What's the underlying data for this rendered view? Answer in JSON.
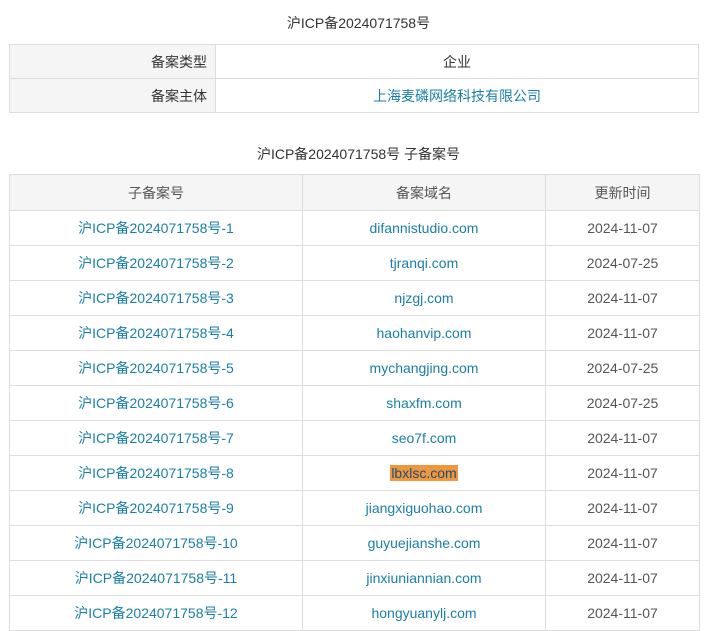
{
  "page": {
    "title": "沪ICP备2024071758号",
    "subtitle": "沪ICP备2024071758号 子备案号"
  },
  "info": {
    "rows": [
      {
        "label": "备案类型",
        "value": "企业"
      },
      {
        "label": "备案主体",
        "value": "上海麦磷网络科技有限公司"
      }
    ]
  },
  "subtable": {
    "headers": [
      "子备案号",
      "备案域名",
      "更新时间"
    ],
    "rows": [
      {
        "number": "沪ICP备2024071758号-1",
        "domain": "difannistudio.com",
        "date": "2024-11-07"
      },
      {
        "number": "沪ICP备2024071758号-2",
        "domain": "tjranqi.com",
        "date": "2024-07-25"
      },
      {
        "number": "沪ICP备2024071758号-3",
        "domain": "njzgj.com",
        "date": "2024-11-07"
      },
      {
        "number": "沪ICP备2024071758号-4",
        "domain": "haohanvip.com",
        "date": "2024-11-07"
      },
      {
        "number": "沪ICP备2024071758号-5",
        "domain": "mychangjing.com",
        "date": "2024-07-25"
      },
      {
        "number": "沪ICP备2024071758号-6",
        "domain": "shaxfm.com",
        "date": "2024-07-25"
      },
      {
        "number": "沪ICP备2024071758号-7",
        "domain": "seo7f.com",
        "date": "2024-11-07"
      },
      {
        "number": "沪ICP备2024071758号-8",
        "domain": "lbxlsc.com",
        "date": "2024-11-07"
      },
      {
        "number": "沪ICP备2024071758号-9",
        "domain": "jiangxiguohao.com",
        "date": "2024-11-07"
      },
      {
        "number": "沪ICP备2024071758号-10",
        "domain": "guyuejianshe.com",
        "date": "2024-11-07"
      },
      {
        "number": "沪ICP备2024071758号-11",
        "domain": "jinxiuniannian.com",
        "date": "2024-11-07"
      },
      {
        "number": "沪ICP备2024071758号-12",
        "domain": "hongyuanylj.com",
        "date": "2024-11-07"
      }
    ]
  },
  "colors": {
    "link": "#1a7fa8",
    "highlight": "#f0963c",
    "header_bg": "#f5f5f5",
    "border": "#dddddd"
  }
}
